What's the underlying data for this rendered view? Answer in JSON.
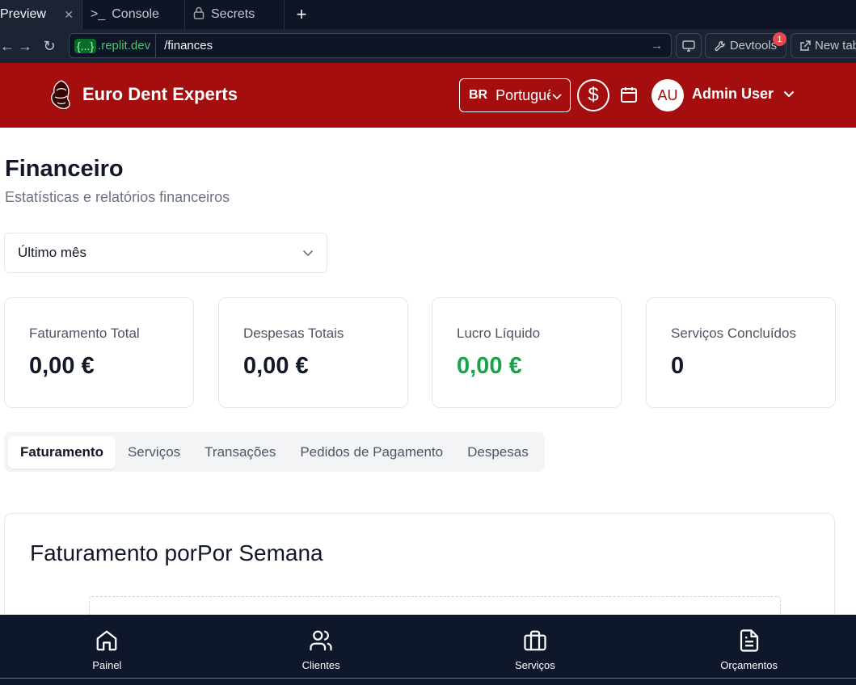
{
  "browser": {
    "tabs": [
      {
        "label": "Preview",
        "active": true
      },
      {
        "label": "Console",
        "active": false
      },
      {
        "label": "Secrets",
        "active": false
      }
    ],
    "new_tab_glyph": "+",
    "url_badge": "{...}",
    "url_domain": ".replit.dev",
    "url_path": "/finances",
    "devtools_label": "Devtools",
    "devtools_count": "1",
    "new_tab_label": "New tab"
  },
  "header": {
    "brand": "Euro Dent Experts",
    "lang_code": "BR",
    "lang_label": "Português",
    "currency_symbol": "$",
    "avatar_initials": "AU",
    "user_name": "Admin User",
    "brand_color": "#a50e0e"
  },
  "page": {
    "title": "Financeiro",
    "subtitle": "Estatísticas e relatórios financeiros",
    "period_selected": "Último mês"
  },
  "stats": [
    {
      "label": "Faturamento Total",
      "value": "0,00 €"
    },
    {
      "label": "Despesas Totais",
      "value": "0,00 €"
    },
    {
      "label": "Lucro Líquido",
      "value": "0,00 €",
      "color": "#16a34a"
    },
    {
      "label": "Serviços Concluídos",
      "value": "0"
    }
  ],
  "tabs": [
    "Faturamento",
    "Serviços",
    "Transações",
    "Pedidos de Pagamento",
    "Despesas"
  ],
  "panel": {
    "title": "Faturamento porPor Semana"
  },
  "bottom_nav": [
    {
      "label": "Painel",
      "icon": "home-icon"
    },
    {
      "label": "Clientes",
      "icon": "users-icon"
    },
    {
      "label": "Serviços",
      "icon": "briefcase-icon"
    },
    {
      "label": "Orçamentos",
      "icon": "file-text-icon"
    }
  ]
}
